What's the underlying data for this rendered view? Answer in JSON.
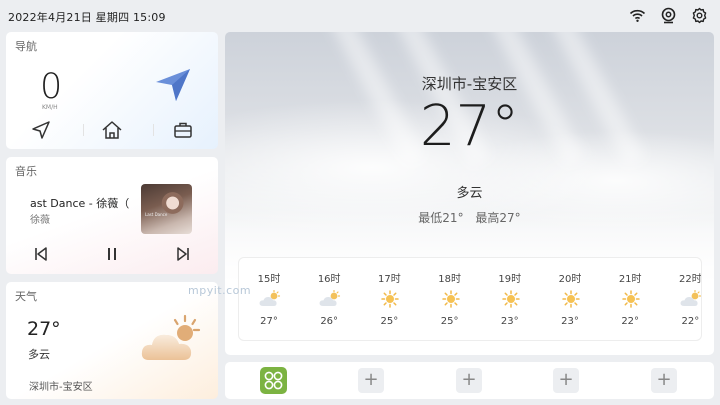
{
  "status_bar": {
    "datetime": "2022年4月21日   星期四   15:09",
    "icons": [
      "wifi-icon",
      "webcam-icon",
      "settings-icon"
    ]
  },
  "navigation_card": {
    "title": "导航",
    "speed": "0",
    "unit": "KM/H",
    "buttons": [
      "navigate-icon",
      "home-icon",
      "work-briefcase-icon"
    ],
    "accent": "#6a8fd9"
  },
  "music_card": {
    "title": "音乐",
    "song": "ast Dance - 徐薇（",
    "artist": "徐薇",
    "album_caption": "Last Dance",
    "controls": [
      "previous-icon",
      "pause-icon",
      "next-icon"
    ]
  },
  "weather_card": {
    "title": "天气",
    "temp": "27°",
    "condition": "多云",
    "location": "深圳市-宝安区",
    "icon": "partly-cloudy-icon"
  },
  "main_weather": {
    "location": "深圳市-宝安区",
    "temp": "27°",
    "condition": "多云",
    "low": "最低21°",
    "high": "最高27°",
    "hourly": [
      {
        "time": "15时",
        "icon": "partly-cloudy-icon",
        "temp": "27°"
      },
      {
        "time": "16时",
        "icon": "partly-cloudy-icon",
        "temp": "26°"
      },
      {
        "time": "17时",
        "icon": "sunny-icon",
        "temp": "25°"
      },
      {
        "time": "18时",
        "icon": "sunny-icon",
        "temp": "25°"
      },
      {
        "time": "19时",
        "icon": "sunny-icon",
        "temp": "23°"
      },
      {
        "time": "20时",
        "icon": "sunny-icon",
        "temp": "23°"
      },
      {
        "time": "21时",
        "icon": "sunny-icon",
        "temp": "22°"
      },
      {
        "time": "22时",
        "icon": "partly-cloudy-icon",
        "temp": "22°"
      }
    ]
  },
  "dock": {
    "app_icon": "app-launcher-icon",
    "app_color": "#7cb342",
    "add_label": "+",
    "slots": 4
  },
  "watermark": "mpyit.com"
}
